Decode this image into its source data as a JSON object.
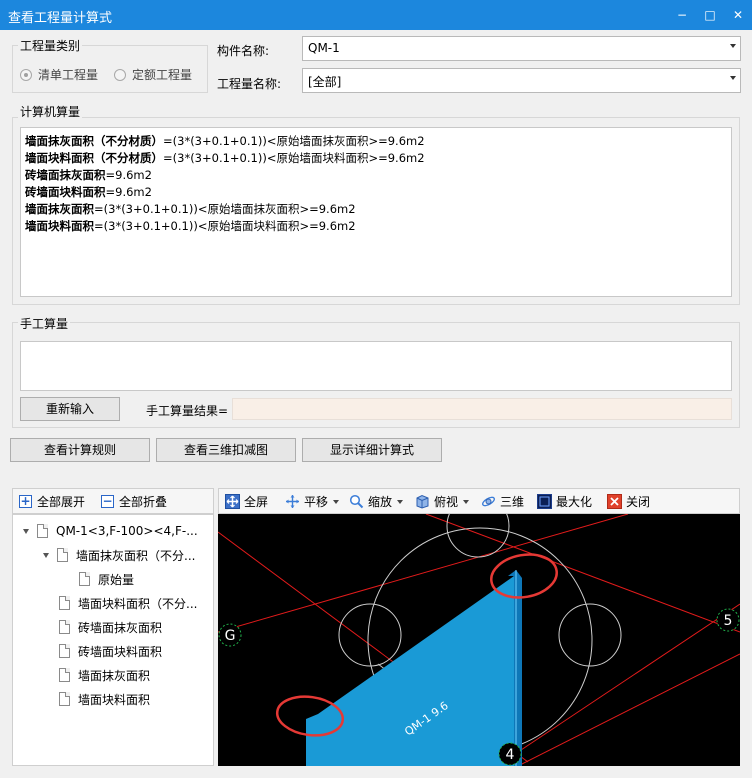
{
  "window": {
    "title": "查看工程量计算式",
    "minimize": "−",
    "maximize": "□",
    "close": "✕"
  },
  "quantity_type": {
    "legend": "工程量类别",
    "options": [
      "清单工程量",
      "定额工程量"
    ],
    "selected": "清单工程量"
  },
  "component": {
    "name_label": "构件名称:",
    "name_value": "QM-1",
    "qty_label": "工程量名称:",
    "qty_value": "[全部]"
  },
  "computer_calc": {
    "legend": "计算机算量",
    "lines": [
      {
        "name": "墙面抹灰面积（不分材质）",
        "formula": "=(3*(3+0.1+0.1))<原始墙面抹灰面积>=9.6m2"
      },
      {
        "name": "墙面块料面积（不分材质）",
        "formula": "=(3*(3+0.1+0.1))<原始墙面块料面积>=9.6m2"
      },
      {
        "name": "砖墙面抹灰面积",
        "formula": "=9.6m2"
      },
      {
        "name": "砖墙面块料面积",
        "formula": "=9.6m2"
      },
      {
        "name": "墙面抹灰面积",
        "formula": "=(3*(3+0.1+0.1))<原始墙面抹灰面积>=9.6m2"
      },
      {
        "name": "墙面块料面积",
        "formula": "=(3*(3+0.1+0.1))<原始墙面块料面积>=9.6m2"
      }
    ]
  },
  "manual_calc": {
    "legend": "手工算量",
    "reinput_button": "重新输入",
    "result_label": "手工算量结果=",
    "result_value": ""
  },
  "actions": {
    "rules_button": "查看计算规则",
    "view3d_button": "查看三维扣减图",
    "detail_button": "显示详细计算式"
  },
  "tree_toolbar": {
    "expand_all": "全部展开",
    "collapse_all": "全部折叠"
  },
  "tree": {
    "root": "QM-1<3,F-100><4,F-...",
    "group": "墙面抹灰面积（不分...",
    "group_child": "原始量",
    "items": [
      "墙面块料面积（不分...",
      "砖墙面抹灰面积",
      "砖墙面块料面积",
      "墙面抹灰面积",
      "墙面块料面积"
    ]
  },
  "view_toolbar": {
    "fullscreen": "全屏",
    "pan": "平移",
    "zoom": "缩放",
    "topview": "俯视",
    "threed": "三维",
    "maximize": "最大化",
    "close": "关闭"
  },
  "viewport": {
    "axis_g": "G",
    "axis_5": "5",
    "axis_4": "4",
    "element_label": "QM-1 9.6",
    "colors": {
      "wall": "#1a9ad6",
      "axis_line": "#e21b1b",
      "marker": "#e53935",
      "circle": "#cfcfcf",
      "axis_bubble": "#22b14c"
    }
  }
}
